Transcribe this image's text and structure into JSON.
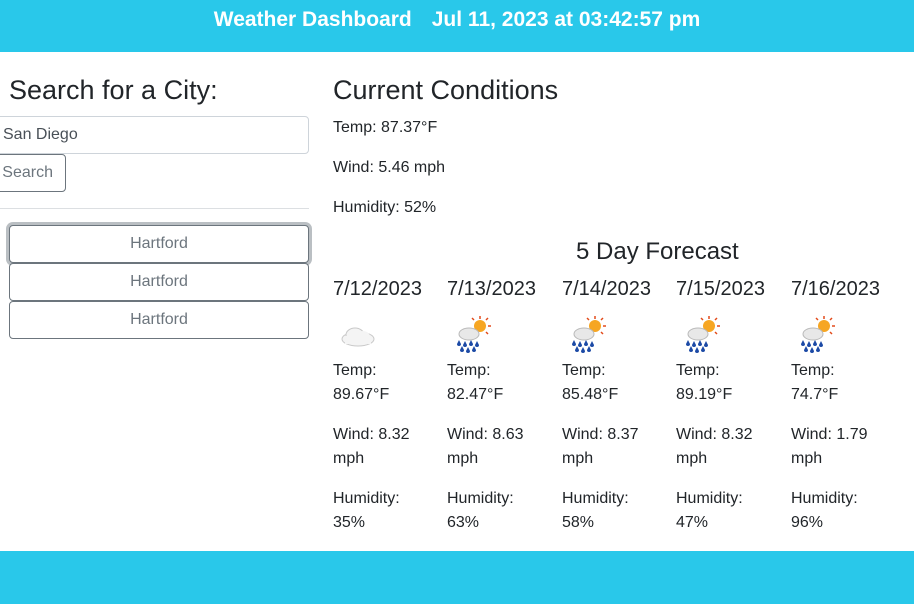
{
  "header": {
    "title": "Weather Dashboard",
    "datetime": "Jul 11, 2023 at 03:42:57 pm"
  },
  "search": {
    "heading": "Search for a City:",
    "input_value": "San Diego",
    "button_label": "Search"
  },
  "history": [
    {
      "label": "Hartford"
    },
    {
      "label": "Hartford"
    },
    {
      "label": "Hartford"
    }
  ],
  "current": {
    "heading": "Current Conditions",
    "temp": "Temp: 87.37°F",
    "wind": "Wind: 5.46 mph",
    "humidity": "Humidity: 52%"
  },
  "forecast": {
    "heading": "5 Day Forecast",
    "days": [
      {
        "date": "7/12/2023",
        "icon": "cloud-icon",
        "temp_label": "Temp:",
        "temp": "89.67°F",
        "wind_label": "Wind: 8.32",
        "wind_unit": "mph",
        "hum_label": "Humidity:",
        "humidity": "35%"
      },
      {
        "date": "7/13/2023",
        "icon": "sun-rain-icon",
        "temp_label": "Temp:",
        "temp": "82.47°F",
        "wind_label": "Wind: 8.63",
        "wind_unit": "mph",
        "hum_label": "Humidity:",
        "humidity": "63%"
      },
      {
        "date": "7/14/2023",
        "icon": "sun-rain-icon",
        "temp_label": "Temp:",
        "temp": "85.48°F",
        "wind_label": "Wind: 8.37",
        "wind_unit": "mph",
        "hum_label": "Humidity:",
        "humidity": "58%"
      },
      {
        "date": "7/15/2023",
        "icon": "sun-rain-icon",
        "temp_label": "Temp:",
        "temp": "89.19°F",
        "wind_label": "Wind: 8.32",
        "wind_unit": "mph",
        "hum_label": "Humidity:",
        "humidity": "47%"
      },
      {
        "date": "7/16/2023",
        "icon": "sun-rain-icon",
        "temp_label": "Temp:",
        "temp": "74.7°F",
        "wind_label": "Wind: 1.79",
        "wind_unit": "mph",
        "hum_label": "Humidity:",
        "humidity": "96%"
      }
    ]
  },
  "colors": {
    "accent": "#29c8ea",
    "secondary": "#6c757d"
  }
}
